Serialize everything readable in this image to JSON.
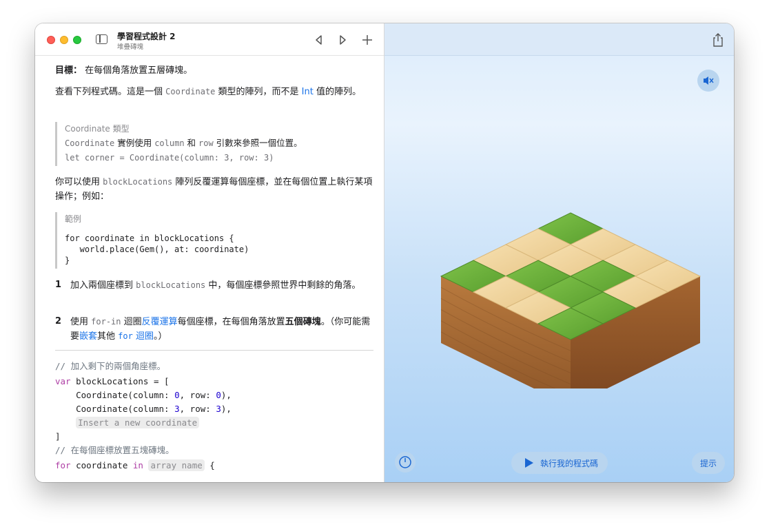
{
  "window": {
    "title": "學習程式設計 2",
    "subtitle": "堆疊磚塊"
  },
  "goal": {
    "label": "目標：",
    "text": "在每個角落放置五層磚塊。"
  },
  "intro": {
    "part1": "查看下列程式碼。這是一個 ",
    "type_name": "Coordinate",
    "part2": " 類型的陣列，而不是 ",
    "int_link": "Int",
    "part3": " 值的陣列。"
  },
  "callout_coordinate": {
    "title": "Coordinate 類型",
    "line1_code": "Coordinate",
    "line1_a": " 實例使用 ",
    "line1_column": "column",
    "line1_b": " 和 ",
    "line1_row": "row",
    "line1_c": " 引數來參照一個位置。",
    "line2": "let corner = Coordinate(column: 3, row: 3)"
  },
  "iterate_para": {
    "part1": "你可以使用 ",
    "code": "blockLocations",
    "part2": " 陣列反覆運算每個座標，並在每個位置上執行某項操作；例如："
  },
  "callout_example": {
    "title": "範例",
    "code": "for coordinate in blockLocations {\n   world.place(Gem(), at: coordinate)\n}"
  },
  "steps": [
    {
      "num": "1",
      "a": "加入兩個座標到 ",
      "code": "blockLocations",
      "b": " 中，每個座標參照世界中剩餘的角落。"
    },
    {
      "num": "2",
      "a": "使用 ",
      "code": "for-in",
      "b": " 迴圈",
      "link1": "反覆運算",
      "c": "每個座標，在每個角落放置",
      "bold": "五個磚塊",
      "d": "。（你可能需要",
      "link2": "嵌套",
      "e": "其他 ",
      "link3_code": "for",
      "f": " ",
      "link4": "迴圈",
      "g": "。）"
    }
  ],
  "editor": {
    "comment1": "// 加入剩下的兩個角座標。",
    "kw_var": "var",
    "decl": " blockLocations = [",
    "coord_prefix": "    Coordinate(column: ",
    "coord_mid": ", row: ",
    "coord_suffix": "),",
    "coord1_col": "0",
    "coord1_row": "0",
    "coord2_col": "3",
    "coord2_row": "3",
    "placeholder_coordinate": "Insert a new coordinate",
    "close_bracket": "]",
    "comment2": "// 在每個座標放置五塊磚塊。",
    "kw_for": "for",
    "loop_var": " coordinate ",
    "kw_in": "in",
    "placeholder_array": "array name",
    "open_brace": " {"
  },
  "live_view": {
    "run_button": "執行我的程式碼",
    "hint_button": "提示"
  },
  "icons": {
    "sidebar": "sidebar-icon",
    "previous": "chevron-left-icon",
    "next": "chevron-right-icon",
    "add": "plus-icon",
    "share": "share-icon",
    "mute": "speaker-muted-icon",
    "speed": "speed-gauge-icon",
    "run": "play-icon"
  },
  "colors": {
    "link": "#1a73e8",
    "keyword": "#ad3da4",
    "number": "#1c00cf",
    "run_accent": "#1a66d2"
  }
}
